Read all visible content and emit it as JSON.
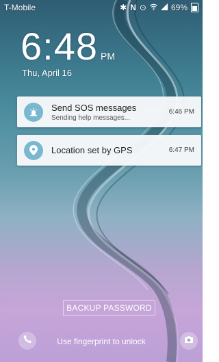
{
  "status_bar": {
    "carrier": "T-Mobile",
    "battery": "69%",
    "icons": [
      "bluetooth-icon",
      "nfc-icon",
      "alarm-icon",
      "wifi-icon",
      "signal-icon",
      "battery-icon"
    ]
  },
  "lockscreen": {
    "time": "6:48",
    "ampm": "PM",
    "date": "Thu, April 16"
  },
  "notifications": [
    {
      "icon": "sos-siren-icon",
      "title": "Send SOS messages",
      "subtitle": "Sending help messages...",
      "time": "6:46 PM"
    },
    {
      "icon": "location-pin-icon",
      "title": "Location set by GPS",
      "subtitle": "",
      "time": "6:47 PM"
    }
  ],
  "backup_password_label": "BACKUP PASSWORD",
  "fingerprint_hint": "Use fingerprint to unlock",
  "shortcuts": {
    "left": "phone-icon",
    "right": "camera-icon"
  },
  "colors": {
    "notif_icon_bg": "#7ab8d0"
  }
}
